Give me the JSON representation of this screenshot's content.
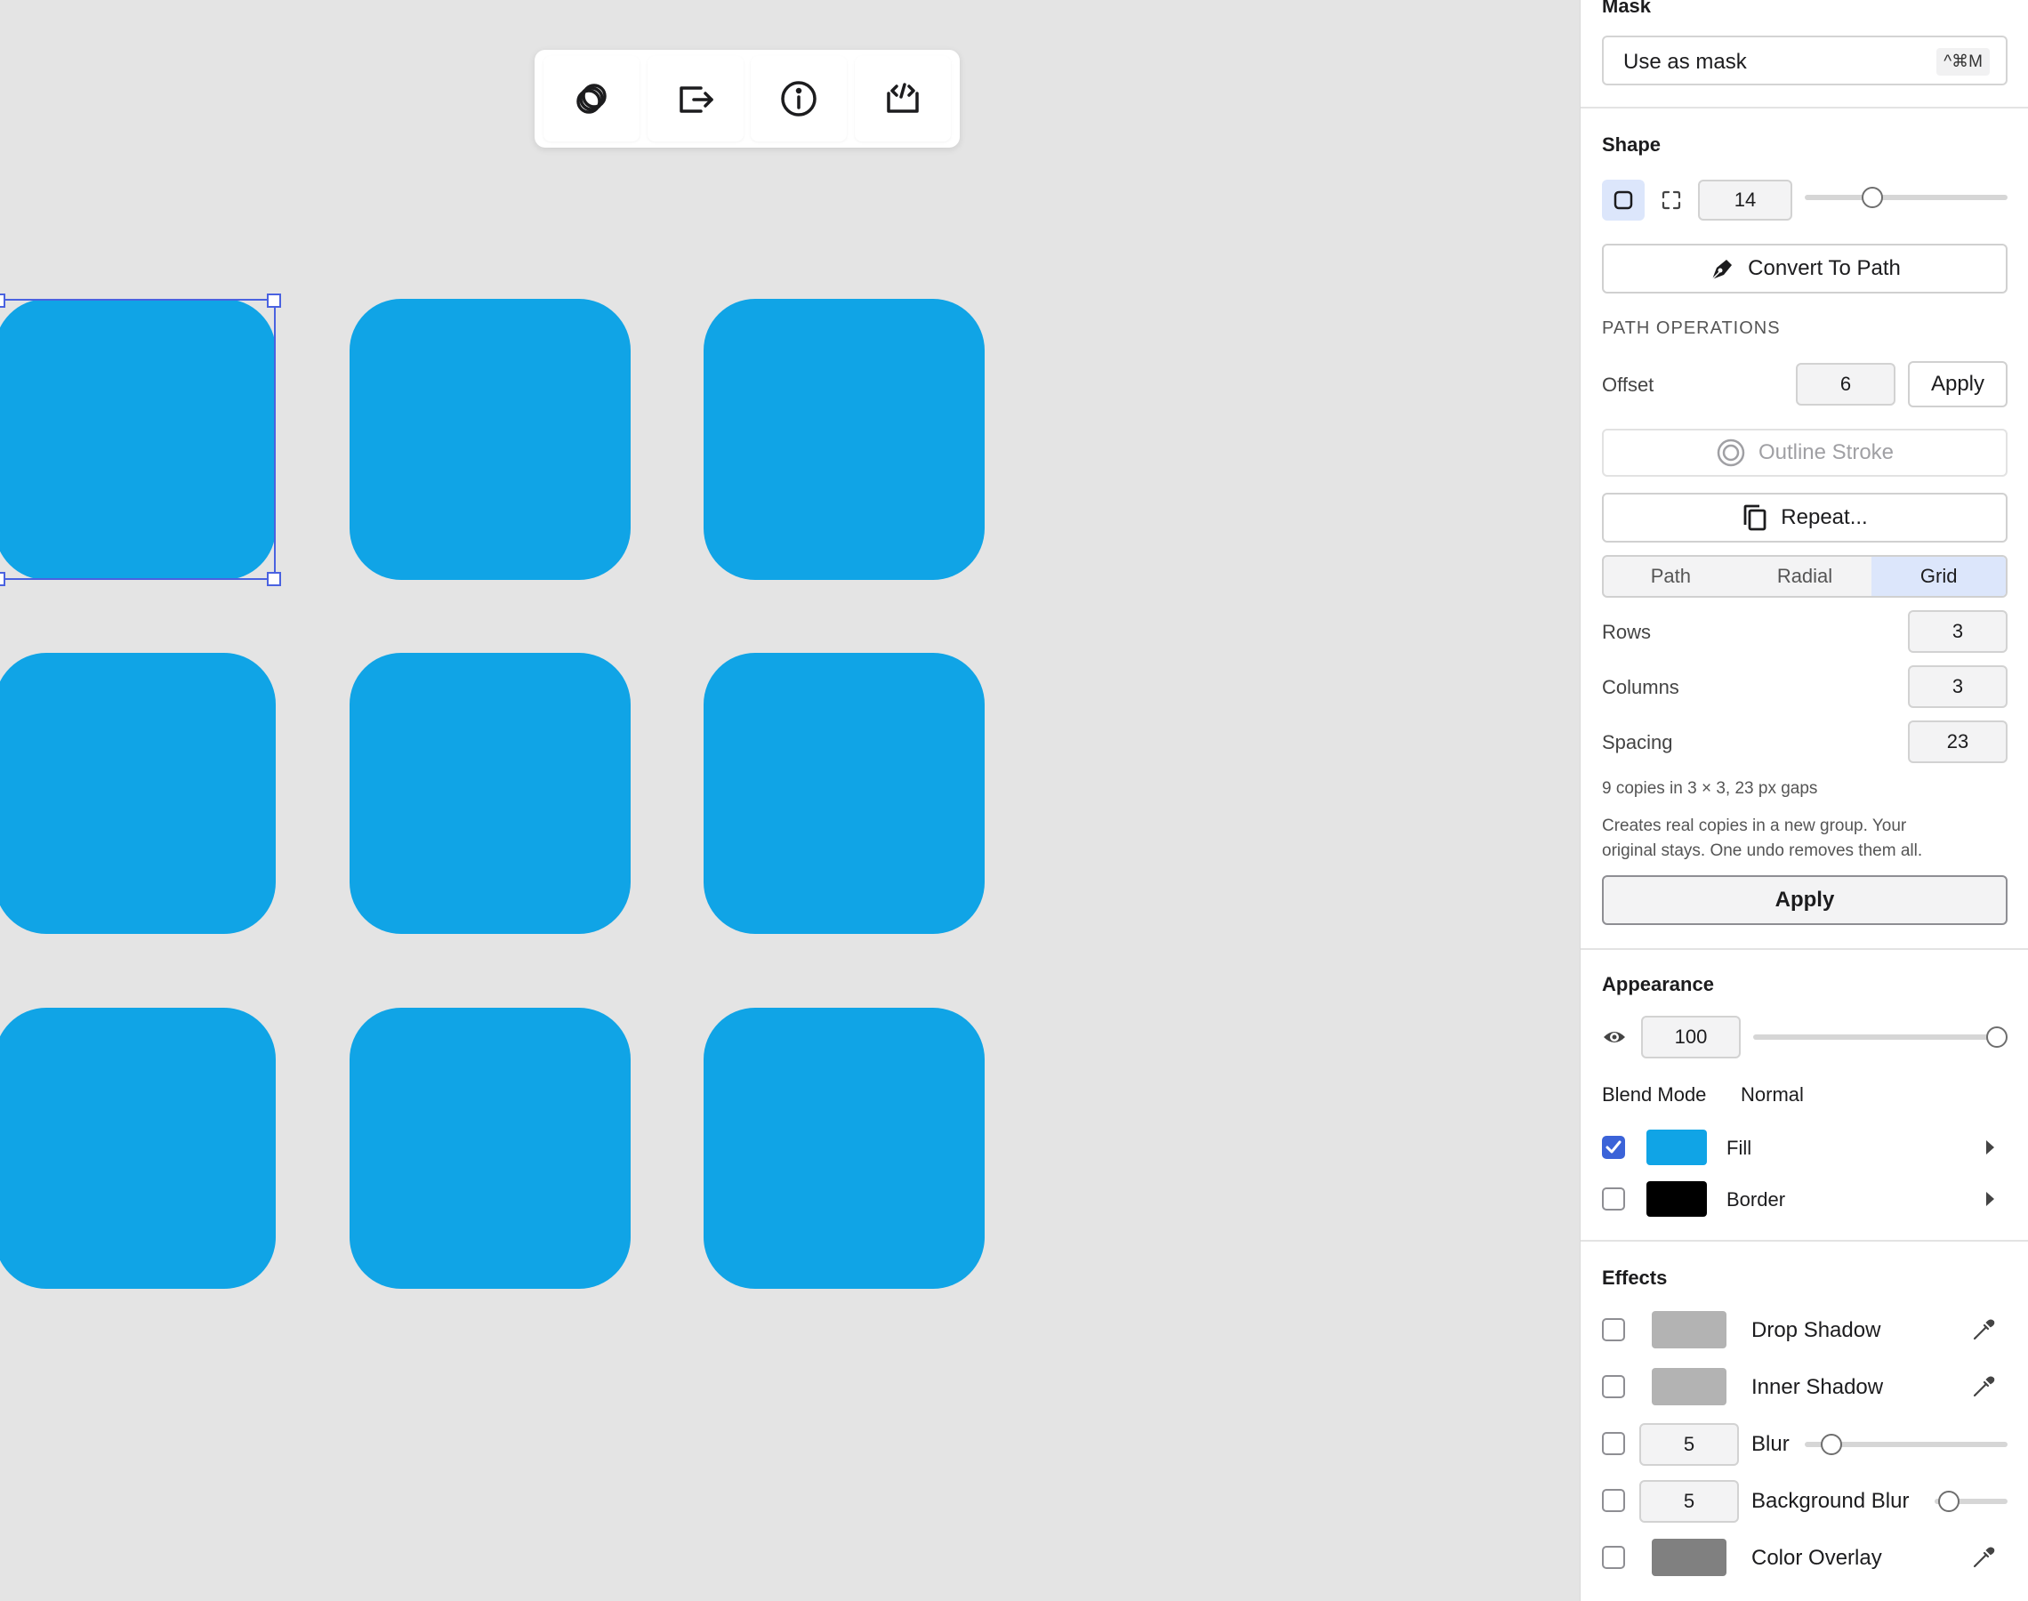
{
  "toolbar": {
    "icons": [
      "overlap-rings-icon",
      "export-icon",
      "info-icon",
      "code-icon"
    ]
  },
  "canvas": {
    "tile_color": "#10a4e6",
    "tile_count": 9,
    "selection_color": "#4a62e0"
  },
  "panel": {
    "mask": {
      "title": "Mask",
      "use_as_mask_label": "Use as mask",
      "shortcut": "^⌘M"
    },
    "shape": {
      "title": "Shape",
      "corner_radius": "14",
      "corner_radius_fraction": 0.33,
      "convert_to_path_label": "Convert To Path"
    },
    "path_operations": {
      "title": "PATH OPERATIONS",
      "offset_label": "Offset",
      "offset_value": "6",
      "apply_label": "Apply",
      "outline_stroke_label": "Outline Stroke",
      "repeat_label": "Repeat..."
    },
    "repeat": {
      "tabs": [
        "Path",
        "Radial",
        "Grid"
      ],
      "active_tab": "Grid",
      "rows_label": "Rows",
      "rows_value": "3",
      "columns_label": "Columns",
      "columns_value": "3",
      "spacing_label": "Spacing",
      "spacing_value": "23",
      "summary": "9 copies in 3 × 3, 23 px gaps",
      "description_line1": "Creates real copies in a new group. Your",
      "description_line2": "original stays. One undo removes them all.",
      "apply_label": "Apply"
    },
    "appearance": {
      "title": "Appearance",
      "opacity": "100",
      "opacity_fraction": 1.0,
      "blend_mode_label": "Blend Mode",
      "blend_mode_value": "Normal",
      "fill_label": "Fill",
      "fill_checked": true,
      "fill_color": "#10a4e6",
      "border_label": "Border",
      "border_checked": false,
      "border_color": "#000000"
    },
    "effects": {
      "title": "Effects",
      "drop_shadow_label": "Drop Shadow",
      "inner_shadow_label": "Inner Shadow",
      "blur_label": "Blur",
      "blur_value": "5",
      "blur_fraction": 0.1,
      "background_blur_label": "Background Blur",
      "background_blur_value": "5",
      "background_blur_fraction": 0.1,
      "color_overlay_label": "Color Overlay",
      "drop_shadow_color": "#b3b3b3",
      "inner_shadow_color": "#b3b3b3",
      "color_overlay_color": "#808080"
    }
  }
}
